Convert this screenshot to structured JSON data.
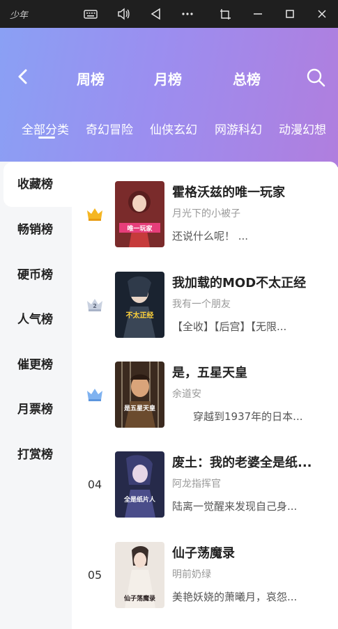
{
  "window": {
    "app_name": "少年",
    "icons": [
      "keyboard-icon",
      "volume-icon",
      "back-triangle-icon",
      "more-icon",
      "screenshot-icon",
      "minimize-icon",
      "maximize-icon",
      "close-icon"
    ]
  },
  "header": {
    "tabs": [
      {
        "label": "周榜"
      },
      {
        "label": "月榜"
      },
      {
        "label": "总榜"
      }
    ],
    "categories": [
      {
        "label": "全部分类"
      },
      {
        "label": "奇幻冒险"
      },
      {
        "label": "仙侠玄幻"
      },
      {
        "label": "网游科幻"
      },
      {
        "label": "动漫幻想"
      }
    ],
    "active_category": "全部分类"
  },
  "sidebar": {
    "items": [
      {
        "label": "收藏榜"
      },
      {
        "label": "畅销榜"
      },
      {
        "label": "硬币榜"
      },
      {
        "label": "人气榜"
      },
      {
        "label": "催更榜"
      },
      {
        "label": "月票榜"
      },
      {
        "label": "打赏榜"
      }
    ],
    "active": "收藏榜"
  },
  "books": [
    {
      "rank": "1",
      "rank_icon": "gold-crown-icon",
      "title": "霍格沃兹的唯一玩家",
      "author": "月光下的小被子",
      "desc": "还说什么呢！ ...",
      "cover_text": "唯一玩家"
    },
    {
      "rank": "2",
      "rank_icon": "silver-crown-icon",
      "title": "我加载的MOD不太正经",
      "author": "我有一个朋友",
      "desc": "【全收】【后宫】【无限...",
      "cover_text": "不太正经"
    },
    {
      "rank": "3",
      "rank_icon": "bronze-crown-icon",
      "title": "是，五星天皇",
      "author": "余道安",
      "desc": "　　穿越到1937年的日本...",
      "cover_text": "是五星天皇"
    },
    {
      "rank": "04",
      "rank_icon": "",
      "title": "废土：我的老婆全是纸...",
      "author": "阿龙指挥官",
      "desc": "陆离一觉醒来发现自己身...",
      "cover_text": "全是纸片人"
    },
    {
      "rank": "05",
      "rank_icon": "",
      "title": "仙子荡魔录",
      "author": "明前奶绿",
      "desc": "美艳妖娆的萧曦月，哀怨...",
      "cover_text": "仙子荡魔录"
    }
  ],
  "colors": {
    "gradient_start": "#8aa0f4",
    "gradient_end": "#b07ede",
    "gold": "#f5b623",
    "silver": "#b8c2d6",
    "bronze": "#7fb2f0"
  }
}
